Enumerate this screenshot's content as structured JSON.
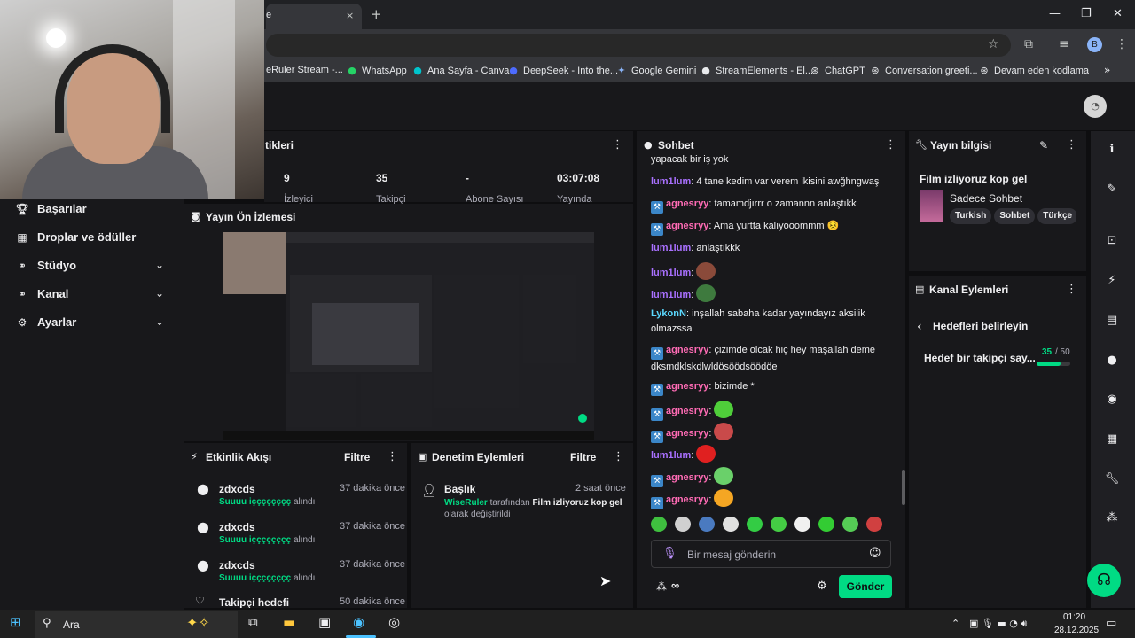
{
  "browser": {
    "tab_title": "e",
    "tab_close": "×",
    "new_tab": "+",
    "bookmarks": [
      {
        "label": "eRuler Stream -...",
        "icon": "page-icon"
      },
      {
        "label": "WhatsApp",
        "icon": "whatsapp-icon"
      },
      {
        "label": "Ana Sayfa - Canva",
        "icon": "canva-icon"
      },
      {
        "label": "DeepSeek - Into the...",
        "icon": "deepseek-icon"
      },
      {
        "label": "Google Gemini",
        "icon": "gemini-icon"
      },
      {
        "label": "StreamElements - El...",
        "icon": "streamelements-icon"
      },
      {
        "label": "ChatGPT",
        "icon": "chatgpt-icon"
      },
      {
        "label": "Conversation greeti...",
        "icon": "chatgpt-icon"
      },
      {
        "label": "Devam eden kodlama",
        "icon": "chatgpt-icon"
      }
    ],
    "profile_initial": "B"
  },
  "nav": {
    "items": [
      {
        "label": "Başarılar",
        "icon": "trophy-icon"
      },
      {
        "label": "Droplar ve ödüller",
        "icon": "gift-icon"
      },
      {
        "label": "Stüdyo",
        "icon": "studio-icon"
      },
      {
        "label": "Kanal",
        "icon": "channel-icon"
      },
      {
        "label": "Ayarlar",
        "icon": "gear-icon"
      }
    ]
  },
  "stats": {
    "title": "tikleri",
    "items": [
      {
        "value": "9",
        "label": "İzleyici"
      },
      {
        "value": "35",
        "label": "Takipçi"
      },
      {
        "value": "-",
        "label": "Abone Sayısı"
      },
      {
        "value": "03:07:08",
        "label": "Yayında"
      }
    ]
  },
  "preview": {
    "title": "Yayın Ön İzlemesi"
  },
  "activity": {
    "title": "Etkinlik Akışı",
    "filter": "Filtre",
    "events": [
      {
        "user": "zdxcds",
        "time": "37 dakika önce",
        "name": "Suuuu içççççççç",
        "suffix": "alındı"
      },
      {
        "user": "zdxcds",
        "time": "37 dakika önce",
        "name": "Suuuu içççççççç",
        "suffix": "alındı"
      },
      {
        "user": "zdxcds",
        "time": "37 dakika önce",
        "name": "Suuuu içççççççç",
        "suffix": "alındı"
      },
      {
        "user": "Takipçi hedefi",
        "time": "50 dakika önce",
        "name": "",
        "suffix": ""
      }
    ]
  },
  "moderation": {
    "title": "Denetim Eylemleri",
    "filter": "Filtre",
    "entry": {
      "title": "Başlık",
      "time": "2 saat önce",
      "actor": "WiseRuler",
      "middle": "tarafından",
      "value": "Film izliyoruz kop gel",
      "end": "olarak değiştirildi"
    }
  },
  "chat": {
    "title": "Sohbet",
    "messages": [
      {
        "user": "",
        "text": "yapacak bir iş yok",
        "color": "p",
        "badge": false
      },
      {
        "user": "lum1lum",
        "text": "4 tane kedim var verem ikisini awğhngwaş",
        "color": "p",
        "badge": false
      },
      {
        "user": "agnesryy",
        "text": "tamamdjırrr o zamannn anlaştıkk",
        "color": "pk",
        "badge": true
      },
      {
        "user": "agnesryy",
        "text": "Ama yurtta kalıyooommm 😣",
        "color": "pk",
        "badge": true
      },
      {
        "user": "lum1lum",
        "text": "anlaştıkkk",
        "color": "p",
        "badge": false
      },
      {
        "user": "lum1lum",
        "text": "",
        "color": "p",
        "badge": false,
        "emote": "#8a4a3a"
      },
      {
        "user": "lum1lum",
        "text": "",
        "color": "p",
        "badge": false,
        "emote": "#3e7a3e"
      },
      {
        "user": "LykonN",
        "text": "inşallah sabaha kadar yayındayız aksilik olmazssa",
        "color": "g",
        "badge": false
      },
      {
        "user": "agnesryy",
        "text": "çizimde olcak hiç hey maşallah deme dksmdklskdlwldösöödsöödöe",
        "color": "pk",
        "badge": true
      },
      {
        "user": "agnesryy",
        "text": "bizimde *",
        "color": "pk",
        "badge": true
      },
      {
        "user": "agnesryy",
        "text": "",
        "color": "pk",
        "badge": true,
        "emote": "#4fce3a"
      },
      {
        "user": "agnesryy",
        "text": "",
        "color": "pk",
        "badge": true,
        "emote": "#c94a4a"
      },
      {
        "user": "lum1lum",
        "text": "",
        "color": "p",
        "badge": false,
        "emote": "#e02020"
      },
      {
        "user": "agnesryy",
        "text": "",
        "color": "pk",
        "badge": true,
        "emote": "#6ad06a"
      },
      {
        "user": "agnesryy",
        "text": "",
        "color": "pk",
        "badge": true,
        "emote": "#f5a623"
      }
    ],
    "emote_row": [
      "#3fbf3f",
      "#d0d0d0",
      "#4a7ac0",
      "#e0e0e0",
      "#33cc44",
      "#44cc44",
      "#f0f0f0",
      "#33cc33",
      "#55cc55",
      "#d04040"
    ],
    "input_placeholder": "Bir mesaj gönderin",
    "send_label": "Gönder",
    "points_label": "∞"
  },
  "stream_info": {
    "title": "Yayın bilgisi",
    "stream_title": "Film izliyoruz kop gel",
    "category": "Sadece Sohbet",
    "tags": [
      "Turkish",
      "Sohbet",
      "Türkçe"
    ]
  },
  "channel_actions": {
    "title": "Kanal Eylemleri",
    "back_label": "Hedefleri belirleyin",
    "goal_label": "Hedef bir takipçi say...",
    "goal_current": "35",
    "goal_total": "/ 50",
    "goal_fraction": 0.7
  },
  "taskbar": {
    "search_label": "Ara",
    "time": "01:20",
    "date": "28.12.2025"
  },
  "colors": {
    "accent_green": "#00db84",
    "twitch_purple": "#a970ff",
    "panel_bg": "#18181b"
  }
}
